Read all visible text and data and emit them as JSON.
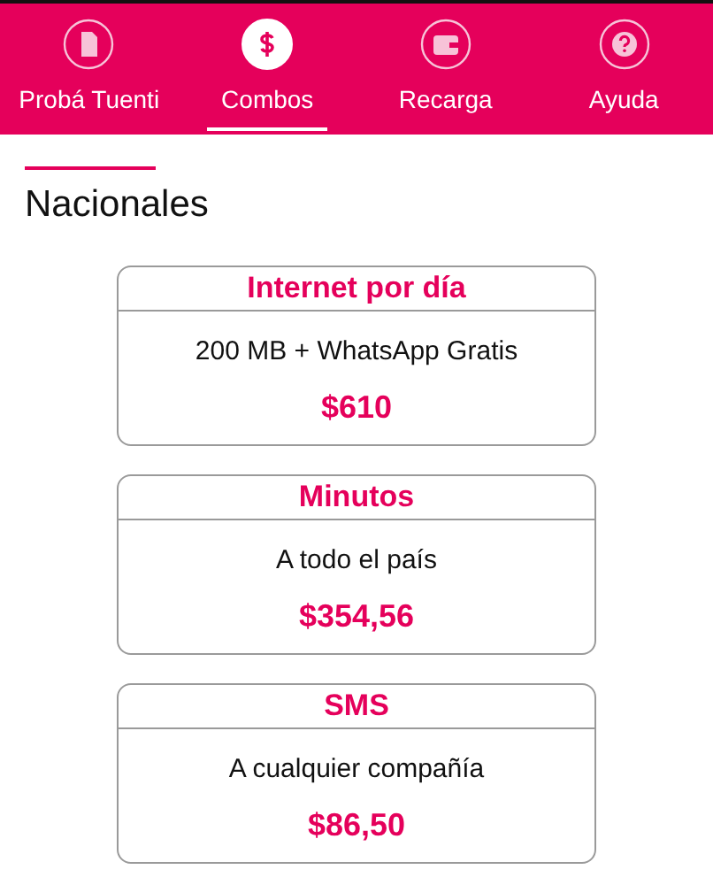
{
  "tabs": [
    {
      "label": "Probá Tuenti",
      "kind": "sim",
      "selected": false
    },
    {
      "label": "Combos",
      "kind": "dollar",
      "selected": true
    },
    {
      "label": "Recarga",
      "kind": "wallet",
      "selected": false
    },
    {
      "label": "Ayuda",
      "kind": "help",
      "selected": false
    }
  ],
  "section": {
    "title": "Nacionales"
  },
  "cards": [
    {
      "title": "Internet por día",
      "description": "200 MB + WhatsApp Gratis",
      "price": "$610"
    },
    {
      "title": "Minutos",
      "description": "A todo el país",
      "price": "$354,56"
    },
    {
      "title": "SMS",
      "description": "A cualquier compañía",
      "price": "$86,50"
    }
  ]
}
